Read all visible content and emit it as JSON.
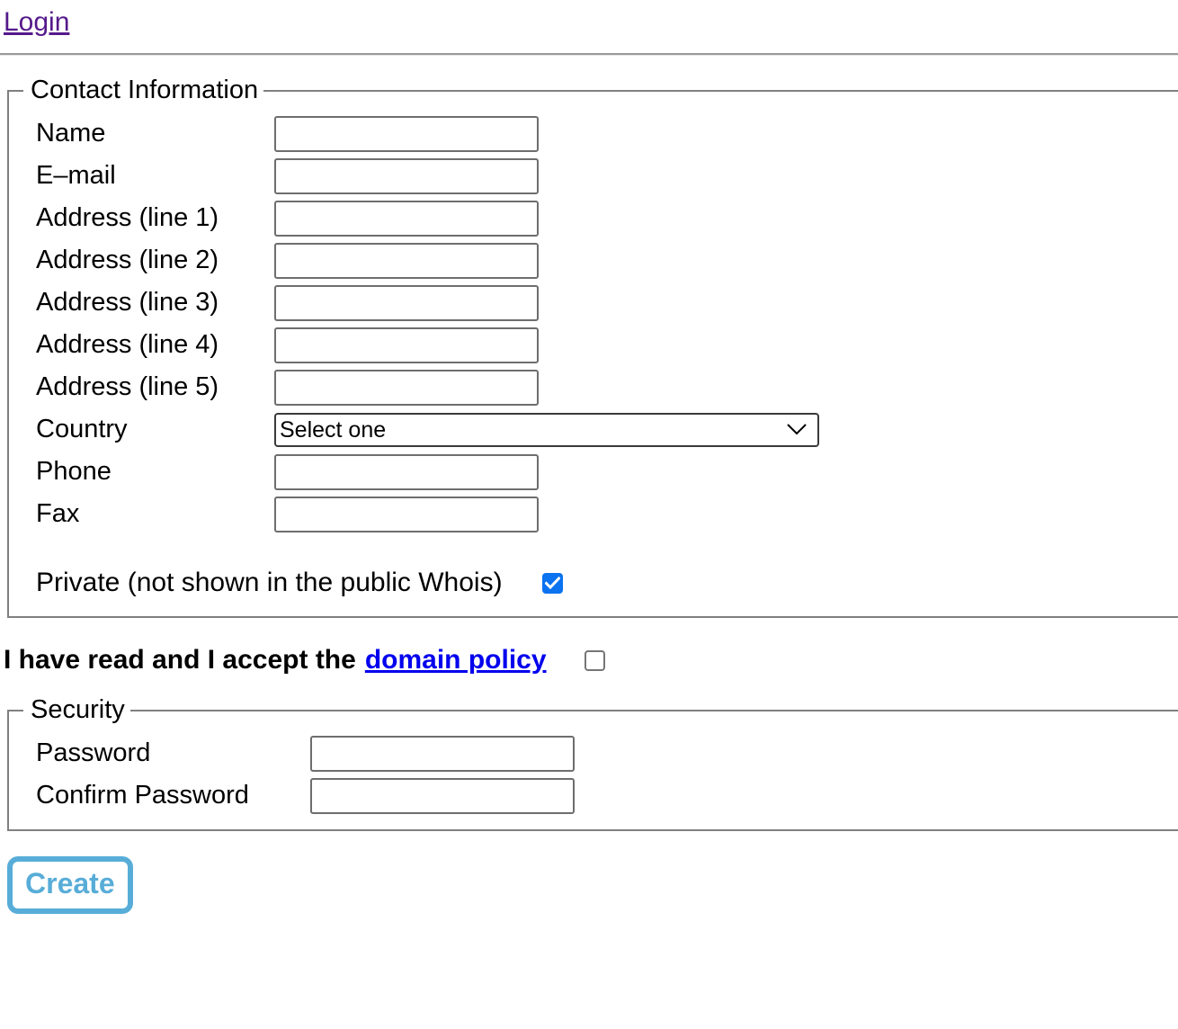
{
  "header": {
    "login_link": "Login"
  },
  "contact": {
    "legend": "Contact Information",
    "fields": [
      {
        "label": "Name",
        "value": "",
        "placeholder": ""
      },
      {
        "label": "E–mail",
        "value": "",
        "placeholder": ""
      },
      {
        "label": "Address (line 1)",
        "value": "",
        "placeholder": ""
      },
      {
        "label": "Address (line 2)",
        "value": "",
        "placeholder": ""
      },
      {
        "label": "Address (line 3)",
        "value": "",
        "placeholder": ""
      },
      {
        "label": "Address (line 4)",
        "value": "",
        "placeholder": ""
      },
      {
        "label": "Address (line 5)",
        "value": "",
        "placeholder": ""
      }
    ],
    "country": {
      "label": "Country",
      "selected": "Select one",
      "options": [
        "Select one"
      ]
    },
    "phone": {
      "label": "Phone",
      "value": "",
      "placeholder": ""
    },
    "fax": {
      "label": "Fax",
      "value": "",
      "placeholder": ""
    },
    "private": {
      "label": "Private (not shown in the public Whois)",
      "checked": true
    }
  },
  "policy": {
    "text": "I have read and I accept the",
    "link_label": "domain policy",
    "checked": false
  },
  "security": {
    "legend": "Security",
    "password": {
      "label": "Password",
      "value": "",
      "placeholder": ""
    },
    "confirm": {
      "label": "Confirm Password",
      "value": "",
      "placeholder": ""
    }
  },
  "actions": {
    "create_label": "Create"
  },
  "colors": {
    "visited_link": "#551A8B",
    "link": "#0000EE",
    "checkbox_checked": "#0B72F0",
    "checkbox_border": "#767676",
    "button_accent": "#58ADD8",
    "field_border": "#6E6E6E",
    "fieldset_border": "#808080"
  }
}
